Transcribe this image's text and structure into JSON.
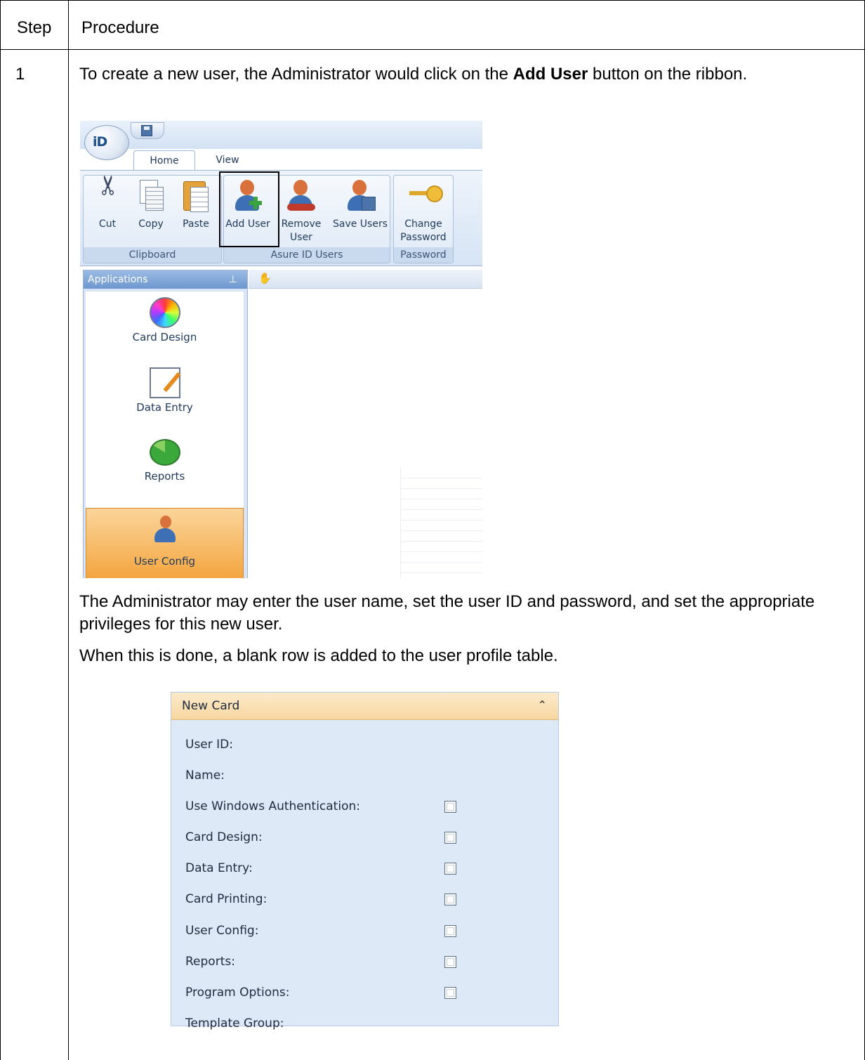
{
  "table": {
    "header_step": "Step",
    "header_procedure": "Procedure",
    "step_number": "1",
    "instruction_pre": "To create a new user, the Administrator would click on the ",
    "instruction_bold": "Add User",
    "instruction_post": " button on the ribbon.",
    "paragraph_2": "The Administrator may enter the user name, set the user ID and password, and set the appropriate privileges for this new user.",
    "paragraph_3": "When this is done, a blank row is added to the user profile table."
  },
  "app_screenshot": {
    "logo_text": "iD",
    "tabs": [
      "Home",
      "View"
    ],
    "active_tab": "Home",
    "ribbon": {
      "groups": [
        {
          "label": "Clipboard",
          "buttons": [
            "Cut",
            "Copy",
            "Paste"
          ]
        },
        {
          "label": "Asure ID Users",
          "buttons": [
            "Add User",
            "Remove User",
            "Save Users"
          ]
        },
        {
          "label": "Password",
          "buttons": [
            "Change Password"
          ]
        }
      ],
      "highlighted_button": "Add User",
      "remove_user_line1": "Remove",
      "remove_user_line2": "User",
      "change_password_line1": "Change",
      "change_password_line2": "Password"
    },
    "applications_panel": {
      "title": "Applications",
      "items": [
        {
          "label": "Card Design",
          "icon": "color-wheel-icon"
        },
        {
          "label": "Data Entry",
          "icon": "notepad-icon"
        },
        {
          "label": "Reports",
          "icon": "pie-chart-icon"
        },
        {
          "label": "User Config",
          "icon": "users-icon"
        }
      ],
      "active_item": "User Config"
    }
  },
  "new_card": {
    "title": "New Card",
    "fields": [
      {
        "label": "User ID:",
        "checkbox": false
      },
      {
        "label": "Name:",
        "checkbox": false
      },
      {
        "label": "Use Windows Authentication:",
        "checkbox": true,
        "checked": false
      },
      {
        "label": "Card Design:",
        "checkbox": true,
        "checked": false
      },
      {
        "label": "Data Entry:",
        "checkbox": true,
        "checked": false
      },
      {
        "label": "Card Printing:",
        "checkbox": true,
        "checked": false
      },
      {
        "label": "User Config:",
        "checkbox": true,
        "checked": false
      },
      {
        "label": "Reports:",
        "checkbox": true,
        "checked": false
      },
      {
        "label": "Program Options:",
        "checkbox": true,
        "checked": false
      },
      {
        "label": "Template Group:",
        "checkbox": false
      }
    ]
  },
  "colors": {
    "card_header": "#f7d7a0",
    "card_body": "#dde9f7",
    "active_nav": "#f4a53f",
    "highlight_border": "#000000"
  }
}
